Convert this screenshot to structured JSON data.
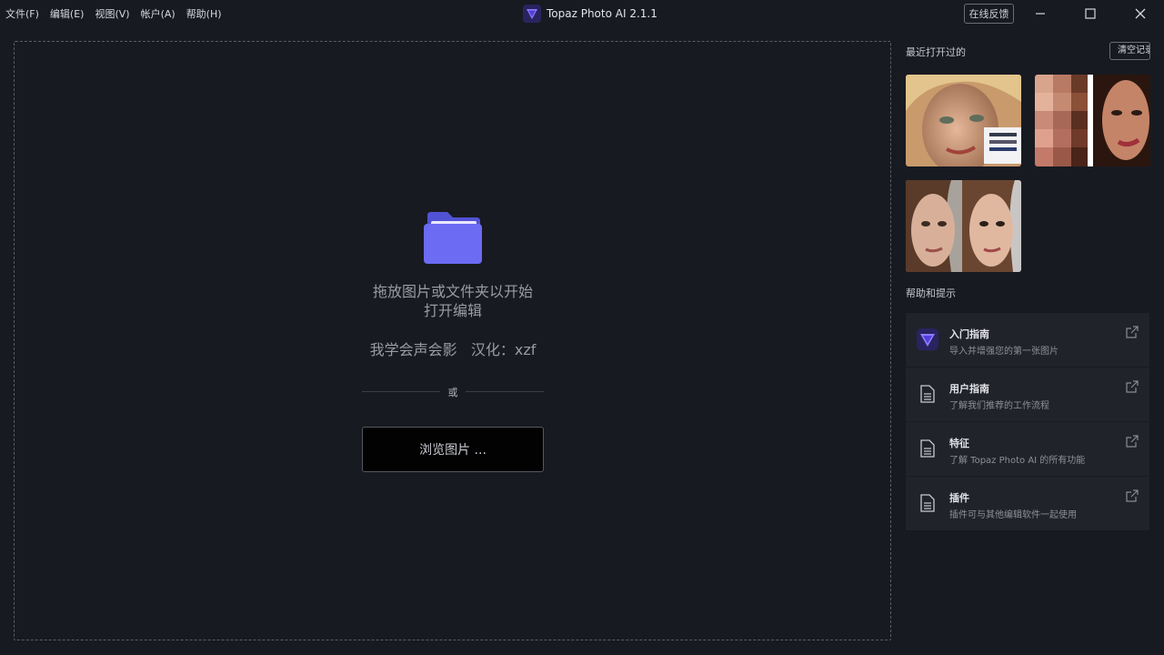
{
  "menu": [
    "文件(F)",
    "编辑(E)",
    "视图(V)",
    "帐户(A)",
    "帮助(H)"
  ],
  "app": {
    "title": "Topaz Photo AI 2.1.1"
  },
  "header": {
    "feedback_label": "在线反馈"
  },
  "dropzone": {
    "line1": "拖放图片或文件夹以开始",
    "line2": "打开编辑",
    "credit": "我学会声会影   汉化：xzf",
    "or_label": "或",
    "browse_label": "浏览图片 ..."
  },
  "recent": {
    "title": "最近打开过的",
    "clear_label": "清空记录"
  },
  "help": {
    "title": "帮助和提示",
    "items": [
      {
        "title": "入门指南",
        "desc": "导入并增强您的第一张图片",
        "icon": "topaz-logo-icon"
      },
      {
        "title": "用户指南",
        "desc": "了解我们推荐的工作流程",
        "icon": "document-icon"
      },
      {
        "title": "特征",
        "desc": "了解 Topaz Photo AI 的所有功能",
        "icon": "document-icon"
      },
      {
        "title": "插件",
        "desc": "插件可与其他编辑软件一起使用",
        "icon": "document-icon"
      }
    ]
  },
  "colors": {
    "background": "#181a21",
    "panel_card": "#21232b",
    "folder": "#6b6bf4",
    "accent": "#4d3fd6"
  }
}
